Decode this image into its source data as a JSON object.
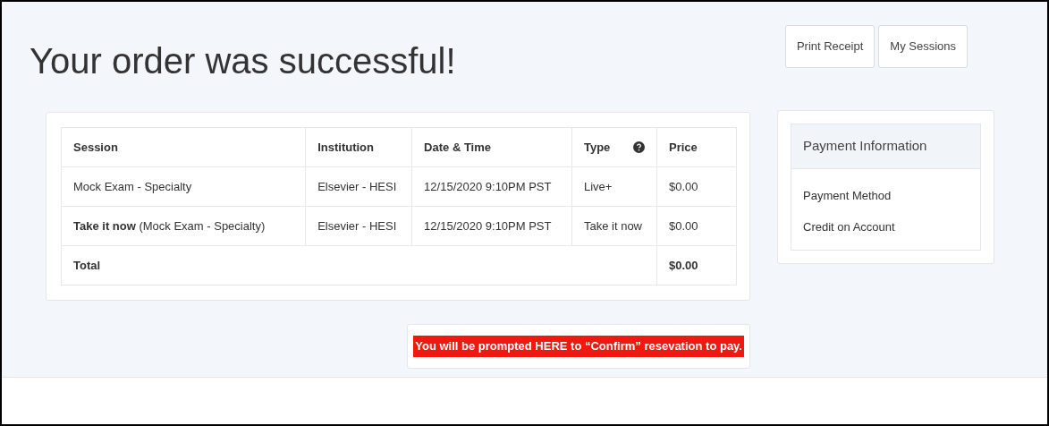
{
  "title": "Your order was successful!",
  "buttons": [
    "Print Receipt",
    "My Sessions"
  ],
  "table": {
    "columns": [
      "Session",
      "Institution",
      "Date & Time",
      "Type",
      "Price"
    ],
    "rows": [
      [
        "Mock Exam - Specialty",
        "Elsevier - HESI",
        "12/15/2020 9:10PM PST",
        "Live+",
        "$0.00"
      ],
      [
        "**Take it now** (Mock Exam - Specialty)",
        "Elsevier - HESI",
        "12/15/2020 9:10PM PST",
        "Take it now",
        "$0.00"
      ]
    ],
    "total": {
      "label": "Total",
      "price": "$0.00"
    }
  },
  "payment": {
    "title": "Payment Information",
    "lines": [
      "Payment Method",
      "Credit on Account"
    ]
  },
  "notice": "You will be prompted  HERE to “Confirm” resevation to pay."
}
